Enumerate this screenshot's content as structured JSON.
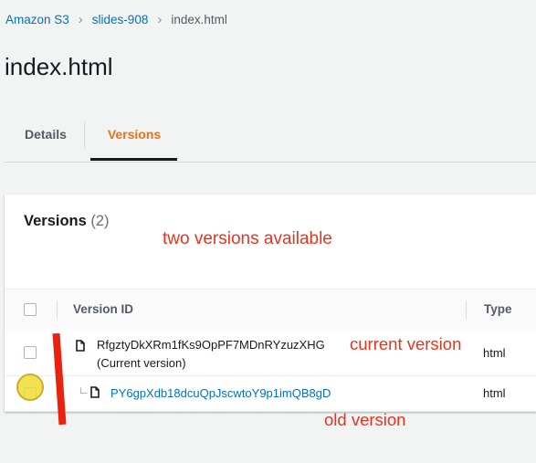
{
  "breadcrumb": {
    "root": "Amazon S3",
    "bucket": "slides-908",
    "current": "index.html"
  },
  "page": {
    "title": "index.html"
  },
  "tabs": {
    "details": "Details",
    "versions": "Versions",
    "active": "Versions"
  },
  "versions_panel": {
    "title": "Versions",
    "count": "(2)"
  },
  "table": {
    "columns": {
      "version_id": "Version ID",
      "type": "Type"
    },
    "rows": [
      {
        "version_id": "RfgztyDkXRm1fKs9OpPF7MDnRYzuzXHG",
        "note": "(Current version)",
        "type": "html"
      },
      {
        "version_id": "PY6gpXdb18dcuQpJscwtoY9p1imQB8gD",
        "type": "html"
      }
    ]
  },
  "annotations": {
    "two_versions": "two versions available",
    "current": "current version",
    "old": "old version"
  },
  "colors": {
    "link": "#0073bb",
    "active_tab": "#ec7211",
    "annotation": "#e8331c"
  },
  "icons": [
    "chevron-right-icon",
    "file-icon",
    "checkbox"
  ]
}
